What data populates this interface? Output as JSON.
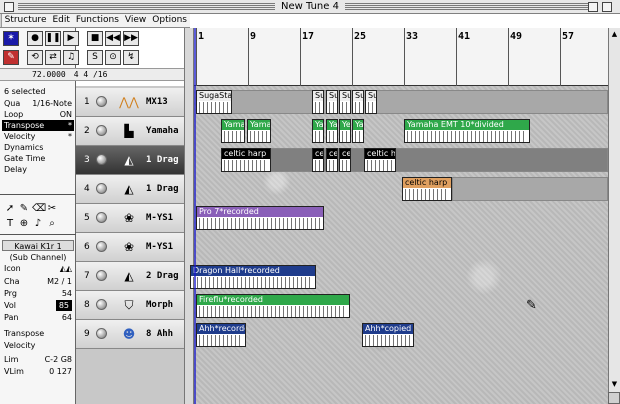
{
  "window": {
    "title": "New Tune 4"
  },
  "menu": [
    "Structure",
    "Edit",
    "Functions",
    "View",
    "Options"
  ],
  "transport": {
    "tempo": "72.0000",
    "signature": "4   4  /16"
  },
  "inspector": {
    "selection": "6 selected",
    "params": [
      {
        "label": "Qua",
        "value": "1/16-Note"
      },
      {
        "label": "Loop",
        "value": "ON"
      },
      {
        "label": "Transpose",
        "value": "*"
      },
      {
        "label": "Velocity",
        "value": "*"
      },
      {
        "label": "Dynamics",
        "value": ""
      },
      {
        "label": "Gate Time",
        "value": ""
      },
      {
        "label": "Delay",
        "value": ""
      }
    ],
    "instrument": {
      "name": "Kawai K1r 1",
      "sub": "(Sub Channel)",
      "icon_label": "Icon",
      "rows": [
        {
          "label": "Cha",
          "value": "M2 / 1"
        },
        {
          "label": "Prg",
          "value": "54"
        },
        {
          "label": "Vol",
          "value": "85"
        },
        {
          "label": "Pan",
          "value": "64"
        }
      ],
      "extra": [
        {
          "label": "Transpose",
          "value": ""
        },
        {
          "label": "Velocity",
          "value": ""
        },
        {
          "label": "Lim",
          "value": "C-2   G8"
        },
        {
          "label": "VLim",
          "value": "0  127"
        }
      ]
    }
  },
  "ruler": {
    "bars": [
      "1",
      "9",
      "17",
      "25",
      "33",
      "41",
      "49",
      "57"
    ]
  },
  "tracks": [
    {
      "num": "1",
      "name": "MX13",
      "icon": "zigzag-icon"
    },
    {
      "num": "2",
      "name": "Yamaha",
      "icon": "piano-icon"
    },
    {
      "num": "3",
      "name": "1 Drag",
      "icon": "triangle-icon"
    },
    {
      "num": "4",
      "name": "1 Drag",
      "icon": "triangle-icon"
    },
    {
      "num": "5",
      "name": "M-YS1",
      "icon": "gear-icon"
    },
    {
      "num": "6",
      "name": "M-YS1",
      "icon": "gear-icon"
    },
    {
      "num": "7",
      "name": "2 Drag",
      "icon": "triangle-icon"
    },
    {
      "num": "8",
      "name": "Morph",
      "icon": "shield-icon"
    },
    {
      "num": "9",
      "name": "8 Ahh",
      "icon": "mask-icon"
    }
  ],
  "regions": {
    "r1a": "SugaStak",
    "r1b": "Su",
    "r1c": "Su",
    "r1d": "Su",
    "r1e": "Su",
    "r1f": "Su",
    "r2a": "Yama",
    "r2b": "Yama",
    "r2c": "Ya",
    "r2d": "Ya",
    "r2e": "Ye",
    "r2f": "Ya",
    "r2g": "Yamaha EMT 10*divided",
    "r3a": "celtic harp",
    "r3b": "ce",
    "r3c": "ce",
    "r3d": "ce",
    "r3e": "celtic h",
    "r4a": "celtic harp",
    "r5a": "Pro 7*recorded",
    "r7a": "Dragon Hall*recorded",
    "r8a": "Fireflu*recorded",
    "r9a": "Ahh*recorde",
    "r9b": "Ahh*copied"
  },
  "colors": {
    "selection": "#1a1aa8",
    "green_region": "#2fa84a",
    "purple_region": "#8a60b8",
    "blue_region": "#1f3c8c",
    "orange_region": "#e0a060"
  }
}
